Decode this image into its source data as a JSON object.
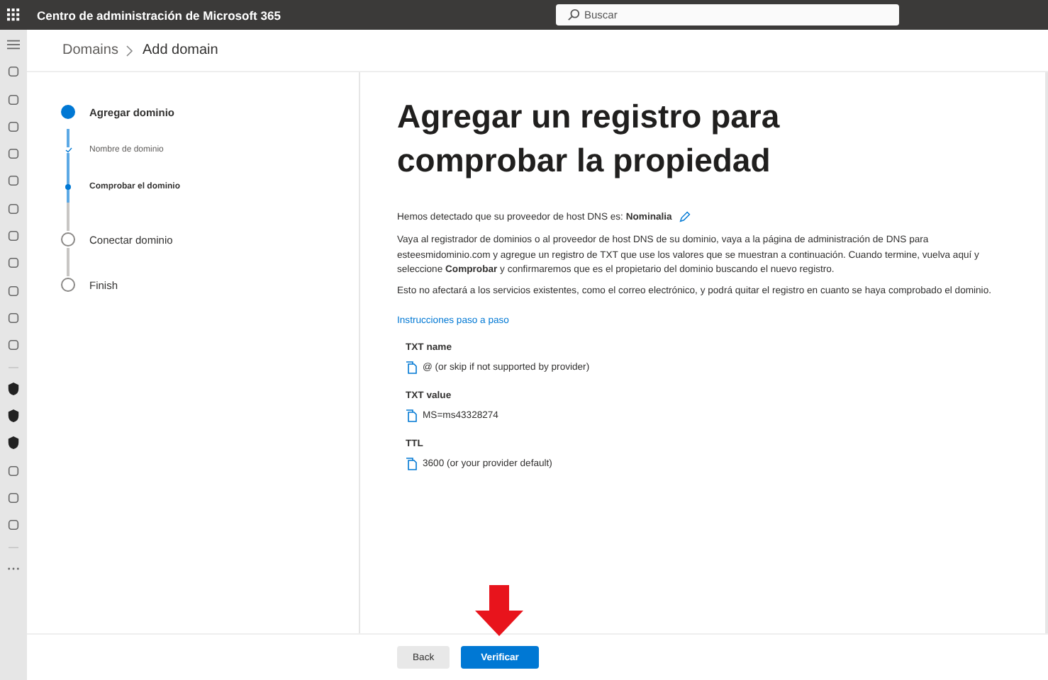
{
  "top_bar": {
    "title": "Centro de administración de Microsoft 365",
    "search": {
      "placeholder": "Buscar"
    }
  },
  "breadcrumb": [
    {
      "label": "Domains",
      "current": false
    },
    {
      "label": "Add domain",
      "current": true
    }
  ],
  "steps": [
    {
      "label": "Agregar dominio",
      "active": true,
      "children": [
        {
          "label": "Nombre de dominio",
          "done": true,
          "active": false
        },
        {
          "label": "Comprobar el dominio",
          "done": false,
          "active": true
        }
      ]
    },
    {
      "label": "Conectar dominio",
      "active": false
    },
    {
      "label": "Finish",
      "active": false
    }
  ],
  "content": {
    "title": "Agregar un registro para comprobar la propiedad",
    "provider_text": "Hemos detectado que su proveedor de host DNS es: **Nominalia**",
    "paragraphs": [
      "Vaya al registrador de dominios o al proveedor de host DNS de su dominio, vaya a la página de administración de DNS para esteesmidominio.com y agregue un registro de TXT que use los valores que se muestran a continuación. Cuando termine, vuelva aquí y seleccione **Comprobar** y confirmaremos que es el propietario del dominio buscando el nuevo registro.",
      "Esto no afectará a los servicios existentes, como el correo electrónico, y podrá quitar el registro en cuanto se haya comprobado el dominio."
    ],
    "link": "Instrucciones paso a paso",
    "records": [
      {
        "label": "TXT name",
        "value": "@ (or skip if not supported by provider)"
      },
      {
        "label": "TXT value",
        "value": "MS=ms43328274"
      },
      {
        "label": "TTL",
        "value": "3600 (or your provider default)"
      }
    ]
  },
  "buttons": [
    {
      "label": "Back",
      "kind": "secondary"
    },
    {
      "label": "Verificar",
      "kind": "primary"
    }
  ]
}
